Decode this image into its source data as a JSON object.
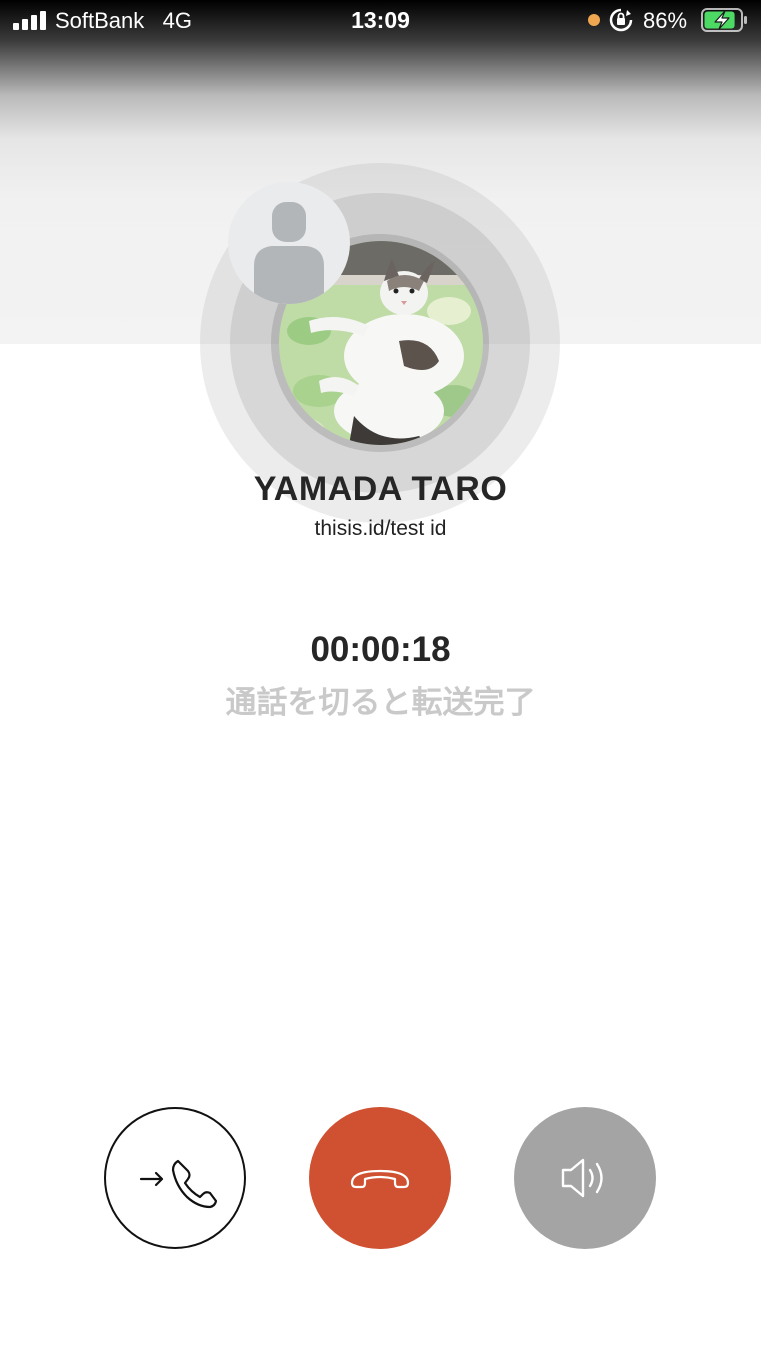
{
  "status_bar": {
    "carrier": "SoftBank",
    "network": "4G",
    "time": "13:09",
    "battery_percent": "86%",
    "battery_level": 0.86,
    "charging": true,
    "indicator_dot_color": "#f0a651"
  },
  "caller": {
    "name": "YAMADA TARO",
    "id": "thisis.id/test id",
    "photo": "cat-photo",
    "placeholder_avatar": "person-silhouette-icon"
  },
  "call": {
    "duration": "00:00:18",
    "note": "通話を切ると転送完了"
  },
  "controls": [
    {
      "name": "transfer",
      "icon": "arrow-phone-icon"
    },
    {
      "name": "hang-up",
      "icon": "hangup-icon",
      "color": "#cf5131"
    },
    {
      "name": "speaker",
      "icon": "speaker-icon",
      "color": "#a4a4a4"
    }
  ]
}
